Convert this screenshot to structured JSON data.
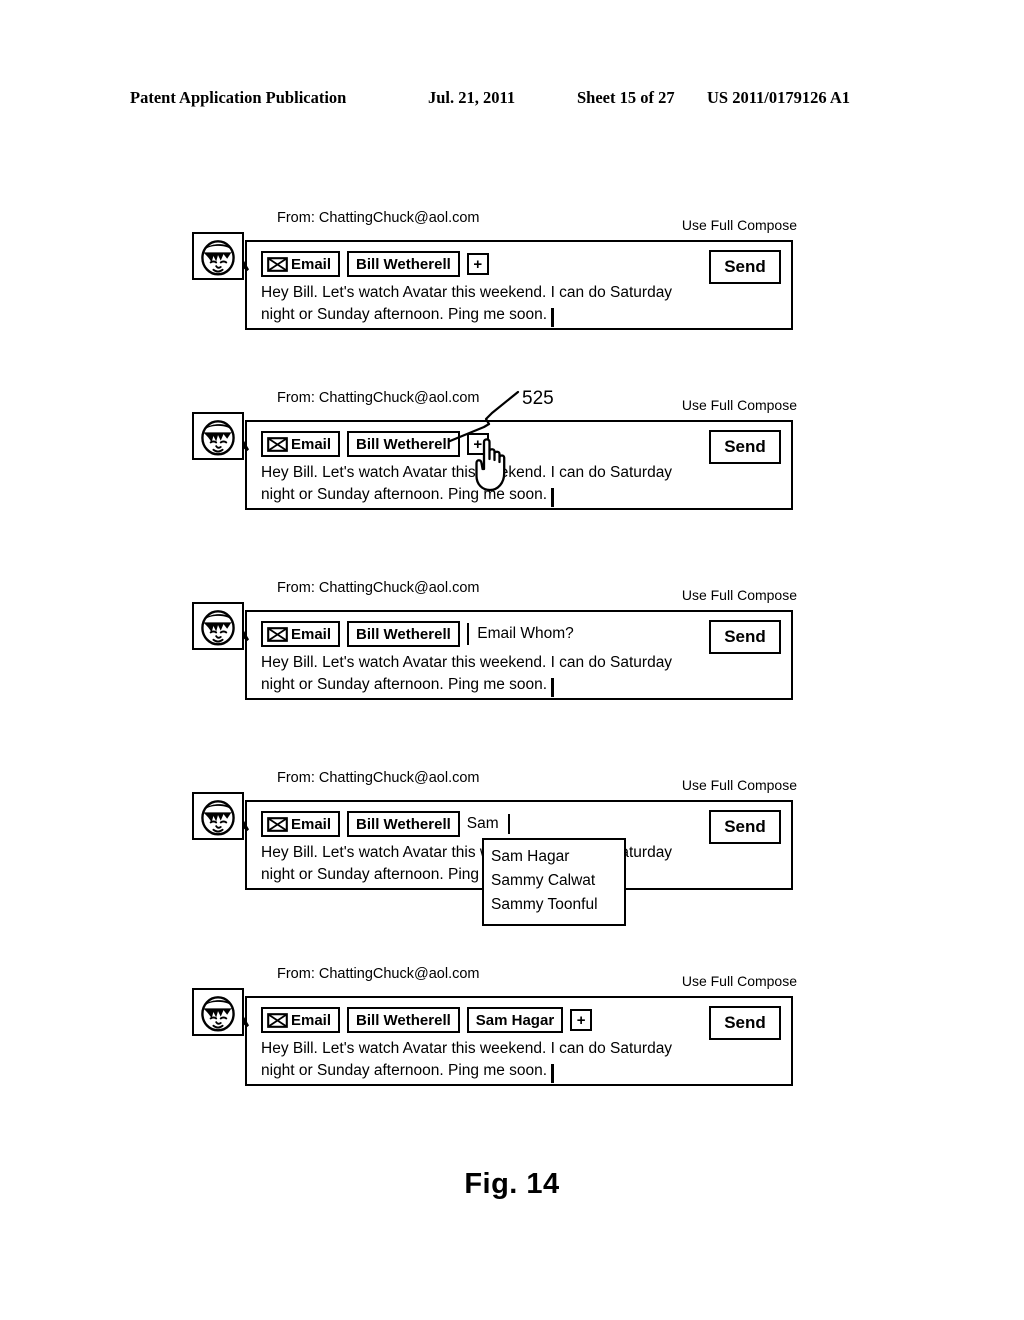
{
  "header": {
    "publication": "Patent Application Publication",
    "date": "Jul. 21, 2011",
    "sheet": "Sheet 15 of 27",
    "patent_number": "US 2011/0179126 A1"
  },
  "figure": {
    "caption": "Fig. 14",
    "reference_numeral": "525"
  },
  "common": {
    "from_label": "From:",
    "from_address": "ChattingChuck@aol.com",
    "full_compose_label": "Use Full Compose",
    "send_label": "Send",
    "email_chip_label": "Email",
    "plus_label": "+",
    "avatar_name": "user-avatar",
    "message_line_1": "Hey Bill.  Let's watch Avatar this weekend.  I can do Saturday",
    "message_line_2": "night or Sunday afternoon.  Ping me soon."
  },
  "panels": [
    {
      "id": "panel-initial",
      "recipients": [
        "Bill Wetherell"
      ],
      "show_plus": true,
      "show_prompt": false,
      "prompt_text": "",
      "typed_text": "",
      "show_hand_cursor": false,
      "show_leader": false,
      "show_dropdown": false
    },
    {
      "id": "panel-plus-clicked",
      "recipients": [
        "Bill Wetherell"
      ],
      "show_plus": true,
      "show_prompt": false,
      "prompt_text": "",
      "typed_text": "",
      "show_hand_cursor": true,
      "show_leader": true,
      "show_dropdown": false
    },
    {
      "id": "panel-prompt",
      "recipients": [
        "Bill Wetherell"
      ],
      "show_plus": false,
      "show_prompt": true,
      "prompt_text": "Email Whom?",
      "typed_text": "",
      "show_hand_cursor": false,
      "show_leader": false,
      "show_dropdown": false
    },
    {
      "id": "panel-autocomplete",
      "recipients": [
        "Bill Wetherell"
      ],
      "show_plus": false,
      "show_prompt": false,
      "prompt_text": "",
      "typed_text": "Sam",
      "show_hand_cursor": false,
      "show_leader": false,
      "show_dropdown": true,
      "dropdown_items": [
        "Sam Hagar",
        "Sammy Calwat",
        "Sammy Toonful"
      ]
    },
    {
      "id": "panel-recipient-added",
      "recipients": [
        "Bill Wetherell",
        "Sam Hagar"
      ],
      "show_plus": true,
      "show_prompt": false,
      "prompt_text": "",
      "typed_text": "",
      "show_hand_cursor": false,
      "show_leader": false,
      "show_dropdown": false
    }
  ],
  "colors": {
    "ink": "#000000",
    "paper": "#ffffff"
  }
}
